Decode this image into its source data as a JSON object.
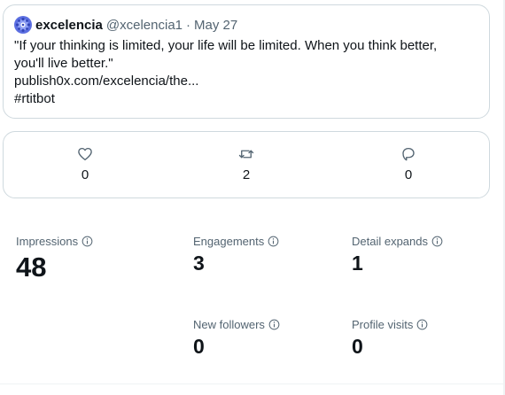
{
  "tweet": {
    "author_name": "excelencia",
    "author_handle": "@xcelencia1",
    "separator": "·",
    "date": "May 27",
    "lines": [
      "\"If your thinking is limited, your life will be limited. When you think better, you'll live better.\"",
      "publish0x.com/excelencia/the...",
      "#rtitbot"
    ],
    "avatar_icon": "mandala-avatar-icon",
    "avatar_color": "#5b6ee1"
  },
  "actions": {
    "like": {
      "icon": "heart-icon",
      "count": "0"
    },
    "retweet": {
      "icon": "retweet-icon",
      "count": "2"
    },
    "reply": {
      "icon": "reply-icon",
      "count": "0"
    }
  },
  "metrics": {
    "impressions": {
      "label": "Impressions",
      "value": "48"
    },
    "engagements": {
      "label": "Engagements",
      "value": "3"
    },
    "detail_expands": {
      "label": "Detail expands",
      "value": "1"
    },
    "new_followers": {
      "label": "New followers",
      "value": "0"
    },
    "profile_visits": {
      "label": "Profile visits",
      "value": "0"
    }
  },
  "colors": {
    "text": "#0f1419",
    "secondary": "#536471",
    "border": "#cfd9de"
  }
}
